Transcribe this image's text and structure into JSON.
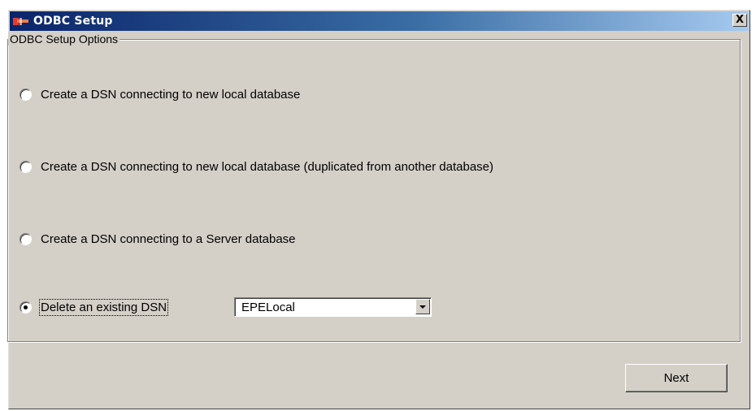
{
  "window": {
    "title": "ODBC Setup",
    "close_label": "X"
  },
  "group": {
    "label": "ODBC Setup Options"
  },
  "options": [
    {
      "label": "Create a DSN connecting to new local database",
      "selected": false
    },
    {
      "label": "Create a DSN connecting to new local database (duplicated from another database)",
      "selected": false
    },
    {
      "label": "Create a DSN connecting to a Server database",
      "selected": false
    },
    {
      "label": "Delete an existing DSN",
      "selected": true
    }
  ],
  "dsn_select": {
    "value": "EPELocal"
  },
  "buttons": {
    "next_label": "Next"
  },
  "colors": {
    "title_bar_start": "#0a246a",
    "title_bar_end": "#a6caf0",
    "face": "#d4d0c8"
  },
  "icons": {
    "app": "app-logo-icon",
    "close": "close-icon",
    "dropdown": "chevron-down-icon"
  }
}
